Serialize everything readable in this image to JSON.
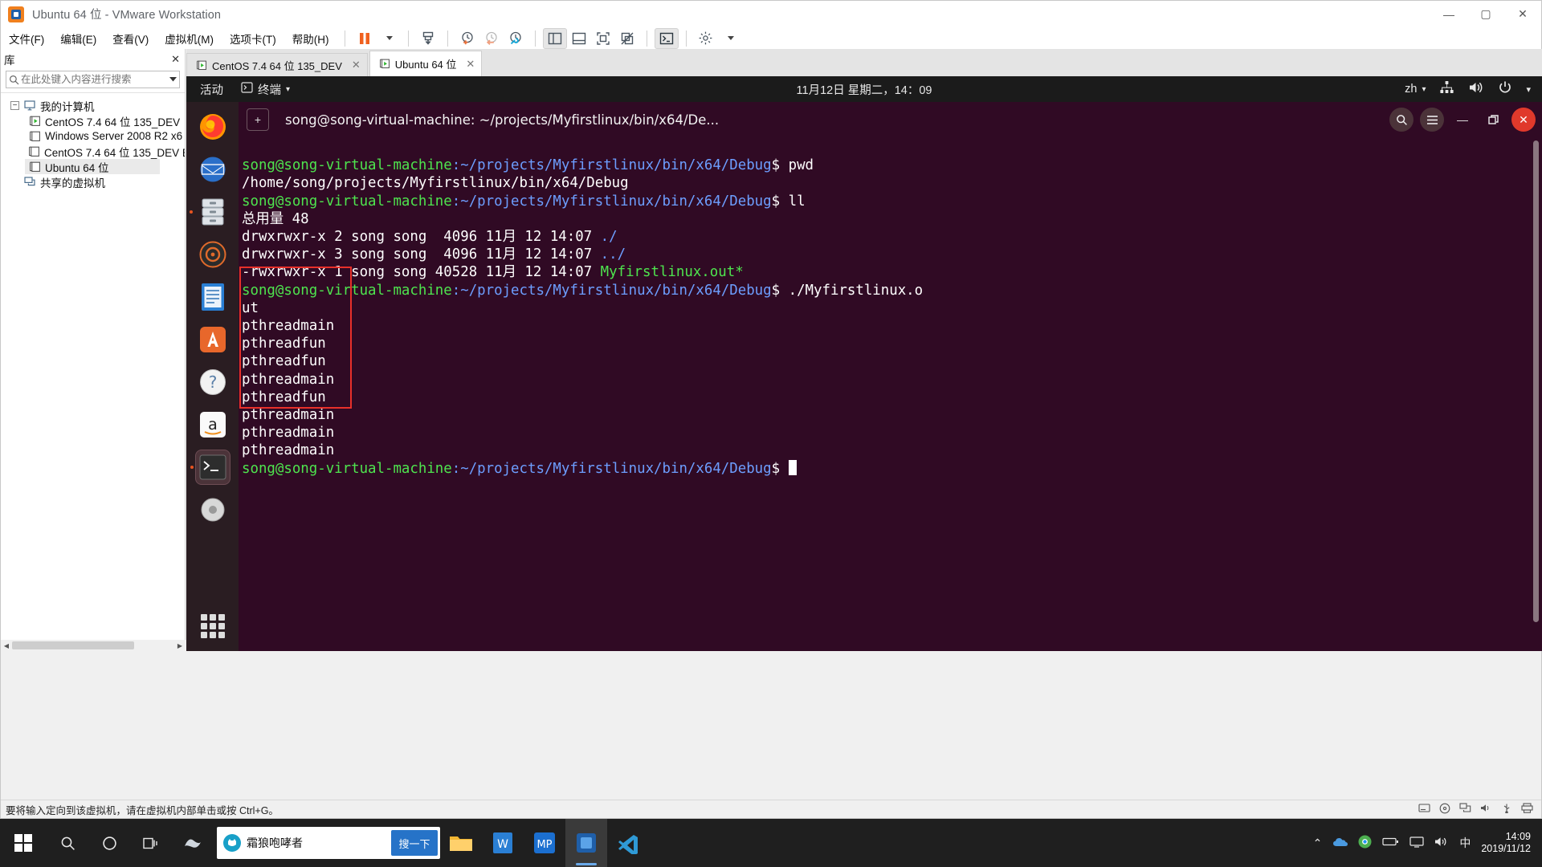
{
  "window": {
    "title": "Ubuntu 64 位 - VMware Workstation",
    "app_icon": "vmware-logo-icon",
    "controls": {
      "minimize": "—",
      "maximize": "▢",
      "close": "✕"
    }
  },
  "menubar": {
    "items": [
      {
        "label": "文件(F)",
        "name": "menu-file"
      },
      {
        "label": "编辑(E)",
        "name": "menu-edit"
      },
      {
        "label": "查看(V)",
        "name": "menu-view"
      },
      {
        "label": "虚拟机(M)",
        "name": "menu-vm"
      },
      {
        "label": "选项卡(T)",
        "name": "menu-tabs"
      },
      {
        "label": "帮助(H)",
        "name": "menu-help"
      }
    ]
  },
  "toolbar": {
    "buttons": [
      {
        "name": "pause-vm-button",
        "icon": "pause-icon"
      },
      {
        "name": "pause-dropdown-button",
        "icon": "chevron-down-icon"
      },
      {
        "name": "send-ctrl-alt-del-button",
        "icon": "send-key-icon"
      },
      {
        "name": "take-snapshot-button",
        "icon": "snapshot-add-icon"
      },
      {
        "name": "revert-snapshot-button",
        "icon": "snapshot-revert-icon"
      },
      {
        "name": "manage-snapshots-button",
        "icon": "snapshot-manage-icon"
      },
      {
        "name": "show-library-button",
        "icon": "panel-left-icon"
      },
      {
        "name": "show-thumbnail-bar-button",
        "icon": "panel-bottom-icon"
      },
      {
        "name": "full-screen-button",
        "icon": "fullscreen-icon"
      },
      {
        "name": "unity-mode-button",
        "icon": "unity-icon"
      },
      {
        "name": "console-view-button",
        "icon": "terminal-icon"
      },
      {
        "name": "preferences-button",
        "icon": "gear-icon"
      },
      {
        "name": "preferences-dropdown-button",
        "icon": "chevron-down-icon"
      }
    ]
  },
  "library": {
    "header": "库",
    "close_label": "✕",
    "search": {
      "placeholder": "在此处键入内容进行搜索",
      "value": "",
      "icon": "search-icon"
    },
    "tree": [
      {
        "label": "我的计算机",
        "icon": "my-computer-icon",
        "level": 0,
        "expanded": true,
        "running": false
      },
      {
        "label": "CentOS 7.4 64 位 135_DEV",
        "icon": "vm-running-icon",
        "level": 1,
        "running": true
      },
      {
        "label": "Windows Server 2008 R2 x6",
        "icon": "vm-icon",
        "level": 1,
        "running": false
      },
      {
        "label": "CentOS 7.4 64 位 135_DEV B",
        "icon": "vm-icon",
        "level": 1,
        "running": false
      },
      {
        "label": "Ubuntu 64 位",
        "icon": "vm-icon",
        "level": 1,
        "running": false,
        "selected": true
      },
      {
        "label": "共享的虚拟机",
        "icon": "shared-vms-icon",
        "level": 0,
        "running": false
      }
    ]
  },
  "vm_tabs": [
    {
      "label": "CentOS 7.4 64 位 135_DEV",
      "icon": "vm-running-icon",
      "active": false,
      "close": "✕"
    },
    {
      "label": "Ubuntu 64 位",
      "icon": "vm-running-icon",
      "active": true,
      "close": "✕"
    }
  ],
  "guest": {
    "gnome_bar": {
      "activities": "活动",
      "app_menu": {
        "label": "终端",
        "icon": "terminal-icon",
        "caret": "▾"
      },
      "datetime": "11月12日 星期二，14：09",
      "input_source": {
        "label": "zh",
        "caret": "▾"
      },
      "status_icons": [
        "network-icon",
        "volume-icon",
        "power-icon"
      ],
      "status_caret": "▾"
    },
    "dock": [
      {
        "name": "dock-firefox",
        "icon": "firefox-icon",
        "running": false
      },
      {
        "name": "dock-thunderbird",
        "icon": "thunderbird-icon",
        "running": false
      },
      {
        "name": "dock-files",
        "icon": "files-icon",
        "running": true
      },
      {
        "name": "dock-rhythmbox",
        "icon": "rhythmbox-icon",
        "running": false
      },
      {
        "name": "dock-libreoffice-writer",
        "icon": "writer-icon",
        "running": false
      },
      {
        "name": "dock-software",
        "icon": "ubuntu-software-icon",
        "running": false
      },
      {
        "name": "dock-help",
        "icon": "help-icon",
        "running": false
      },
      {
        "name": "dock-amazon",
        "icon": "amazon-icon",
        "running": false
      },
      {
        "name": "dock-terminal",
        "icon": "terminal-icon",
        "running": true,
        "current": true
      },
      {
        "name": "dock-trash",
        "icon": "trash-icon",
        "running": false
      },
      {
        "name": "dock-show-apps",
        "icon": "show-applications-icon",
        "running": false
      }
    ],
    "terminal": {
      "titlebar": {
        "new_tab_label": "+",
        "title": "song@song-virtual-machine: ~/projects/Myfirstlinux/bin/x64/De...",
        "search_icon": "search-icon",
        "menu_icon": "hamburger-menu-icon",
        "minimize": "—",
        "maximize": "▢",
        "close": "✕"
      },
      "prompt_user": "song@song-virtual-machine",
      "prompt_path": ":~/projects/Myfirstlinux/bin/x64/Debug",
      "prompt_sym": "$ ",
      "lines": [
        {
          "type": "prompt",
          "command": "pwd"
        },
        {
          "type": "out",
          "text": "/home/song/projects/Myfirstlinux/bin/x64/Debug"
        },
        {
          "type": "prompt",
          "command": "ll"
        },
        {
          "type": "out",
          "text": "总用量 48"
        },
        {
          "type": "out",
          "text": "drwxrwxr-x 2 song song  4096 11月 12 14:07 ",
          "suffix": "./",
          "suffix_color": "blue"
        },
        {
          "type": "out",
          "text": "drwxrwxr-x 3 song song  4096 11月 12 14:07 ",
          "suffix": "../",
          "suffix_color": "blue"
        },
        {
          "type": "out",
          "text": "-rwxrwxr-x 1 song song 40528 11月 12 14:07 ",
          "suffix": "Myfirstlinux.out*",
          "suffix_color": "green"
        },
        {
          "type": "prompt",
          "command": "./Myfirstlinux.o"
        },
        {
          "type": "out",
          "text": "ut"
        },
        {
          "type": "out",
          "text": "pthreadmain"
        },
        {
          "type": "out",
          "text": "pthreadfun"
        },
        {
          "type": "out",
          "text": "pthreadfun"
        },
        {
          "type": "out",
          "text": "pthreadmain"
        },
        {
          "type": "out",
          "text": "pthreadfun"
        },
        {
          "type": "out",
          "text": "pthreadmain"
        },
        {
          "type": "out",
          "text": "pthreadmain"
        },
        {
          "type": "out",
          "text": "pthreadmain"
        },
        {
          "type": "prompt",
          "command": "",
          "cursor": true
        }
      ],
      "highlight_box": {
        "color": "#e8302a",
        "label": "output-highlight-box"
      }
    }
  },
  "vm_status": {
    "message": "要将输入定向到该虚拟机，请在虚拟机内部单击或按 Ctrl+G。",
    "icons": [
      "hdd-icon",
      "cd-icon",
      "network-icon",
      "sound-icon",
      "usb-icon",
      "printer-icon"
    ]
  },
  "taskbar": {
    "start_icon": "windows-start-icon",
    "search_icon": "search-icon",
    "cortana_icon": "cortana-icon",
    "taskview_icon": "task-view-icon",
    "apps": [
      {
        "name": "taskbar-app-s-logo",
        "icon": "sogou-s-icon"
      },
      {
        "name": "taskbar-search-box",
        "icon": "wolf-icon",
        "text": "霜狼咆哮者",
        "button": "搜一下"
      },
      {
        "name": "taskbar-app-explorer",
        "icon": "file-explorer-icon"
      },
      {
        "name": "taskbar-app-wps",
        "icon": "wps-writer-icon"
      },
      {
        "name": "taskbar-app-mp",
        "icon": "mp-icon",
        "label": "MP"
      },
      {
        "name": "taskbar-app-vmware",
        "icon": "vmware-icon",
        "active": true
      },
      {
        "name": "taskbar-app-vscode",
        "icon": "vscode-icon"
      }
    ],
    "tray": {
      "expand": "⌃",
      "icons": [
        "onedrive-icon",
        "chrome-icon",
        "battery-icon",
        "screen-icon",
        "volume-icon",
        "ime-zh-icon"
      ],
      "ime_label": "中",
      "clock_time": "14:09",
      "clock_date": "2019/11/12"
    }
  },
  "colors": {
    "vmware_orange": "#f0801e",
    "terminal_bg": "#300a24",
    "prompt_green": "#4ee44e",
    "prompt_blue": "#6d9eff",
    "ubuntu_accent": "#e95420",
    "highlight_red": "#e8302a",
    "taskbar_bg": "#1f1f1f"
  }
}
